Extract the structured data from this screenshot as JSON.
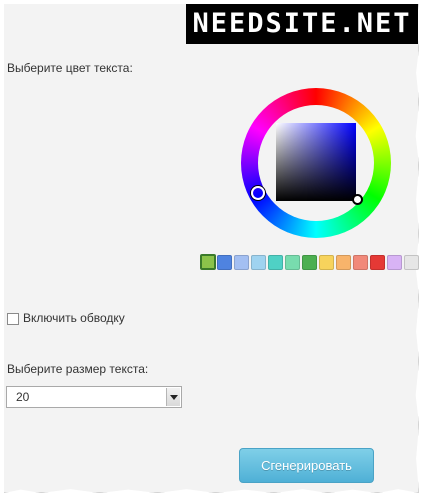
{
  "logo": {
    "text": "NEEDSITE.NET"
  },
  "text_color": {
    "label": "Выберите цвет текста:",
    "swatches": [
      "#8bc34a",
      "#4f83e0",
      "#a3bff2",
      "#9fd3f0",
      "#4fd1c5",
      "#78dcae",
      "#4caf50",
      "#f7d35c",
      "#f8b46b",
      "#f1897a",
      "#e53935",
      "#d8b3f5",
      "#e6e6e6"
    ],
    "selected_index": 0
  },
  "stroke": {
    "label": "Включить обводку",
    "checked": false
  },
  "text_size": {
    "label": "Выберите размер текста:",
    "value": "20"
  },
  "generate_button": {
    "label": "Сгенерировать"
  }
}
